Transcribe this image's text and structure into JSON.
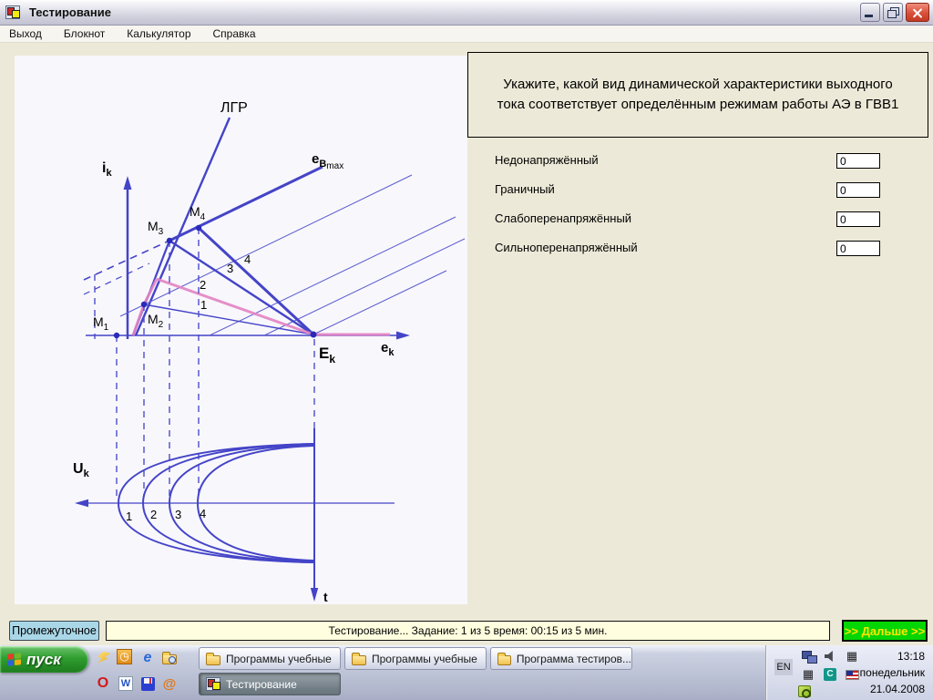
{
  "window": {
    "title": "Тестирование"
  },
  "menu": {
    "items": [
      "Выход",
      "Блокнот",
      "Калькулятор",
      "Справка"
    ]
  },
  "question": {
    "text": "Укажите, какой вид динамической характеристики выходного тока соответствует определённым режимам работы АЭ в ГВВ1"
  },
  "answers": [
    {
      "label": "Недонапряжённый",
      "value": "0"
    },
    {
      "label": "Граничный",
      "value": "0"
    },
    {
      "label": "Слабоперенапряжённый",
      "value": "0"
    },
    {
      "label": "Сильноперенапряжённый",
      "value": "0"
    }
  ],
  "diagram": {
    "lgr": "ЛГР",
    "ik": {
      "main": "i",
      "sub": "k"
    },
    "ebmax": {
      "main": "e",
      "sub": "B",
      "sub2": "max"
    },
    "ek": {
      "main": "e",
      "sub": "k"
    },
    "Ek": {
      "main": "E",
      "sub": "k"
    },
    "uk": {
      "main": "U",
      "sub": "k"
    },
    "t": "t",
    "m_points": [
      {
        "main": "M",
        "sub": "1"
      },
      {
        "main": "M",
        "sub": "2"
      },
      {
        "main": "M",
        "sub": "3"
      },
      {
        "main": "M",
        "sub": "4"
      }
    ],
    "line_labels": [
      "1",
      "2",
      "3",
      "4"
    ],
    "curve_labels": [
      "1",
      "2",
      "3",
      "4"
    ]
  },
  "bottom_bar": {
    "intermediate_button": "Промежуточное",
    "status": "Тестирование... Задание: 1 из 5 время: 00:15 из 5 мин.",
    "next_button": ">> Дальше >>"
  },
  "taskbar": {
    "start": "пуск",
    "buttons": [
      {
        "label": "Программы учебные"
      },
      {
        "label": "Программы учебные"
      },
      {
        "label": "Программа тестиров..."
      },
      {
        "label": "Тестирование"
      }
    ],
    "tray": {
      "lang": "EN",
      "time": "13:18",
      "day": "понедельник",
      "date": "21.04.2008"
    }
  },
  "icons": {
    "ie": "e",
    "opera": "O",
    "word": "W",
    "at": "@",
    "clock": "◷",
    "grid": "▦",
    "teal_c": "C"
  },
  "colors": {
    "diagram_blue": "#4444c8",
    "diagram_pink": "#e383c3",
    "next_green": "#04d504",
    "next_text": "#ffe600",
    "status_bg": "#ffffdf",
    "intermediate_bg": "#a9d7e8"
  }
}
